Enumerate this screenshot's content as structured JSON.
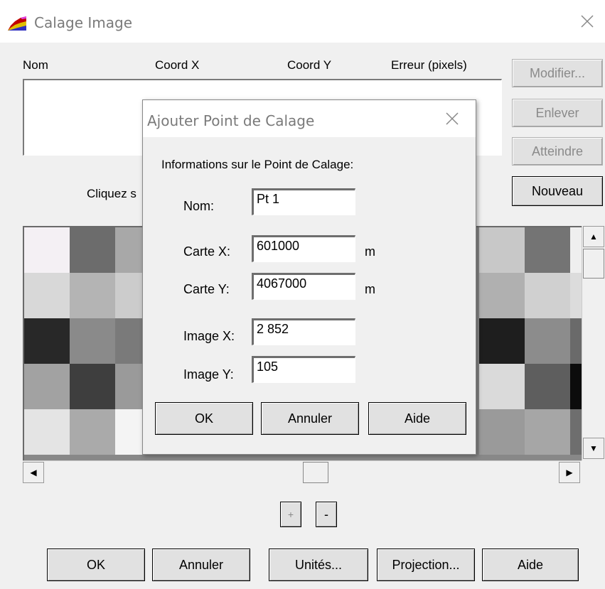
{
  "window": {
    "title": "Calage Image",
    "icon": "app-icon",
    "close_icon": "close-icon"
  },
  "list": {
    "columns": [
      "Nom",
      "Coord X",
      "Coord Y",
      "Erreur (pixels)"
    ],
    "rows": []
  },
  "side_buttons": {
    "modifier": "Modifier...",
    "enlever": "Enlever",
    "atteindre": "Atteindre",
    "nouveau": "Nouveau"
  },
  "instruction_text": "Cliquez s",
  "zoom": {
    "plus": "+",
    "minus": "-"
  },
  "footer_buttons": {
    "ok": "OK",
    "annuler": "Annuler",
    "unites": "Unités...",
    "projection": "Projection...",
    "aide": "Aide"
  },
  "dialog": {
    "title": "Ajouter Point de Calage",
    "section_label": "Informations sur le Point de Calage:",
    "fields": {
      "nom": {
        "label": "Nom:",
        "value": "Pt 1"
      },
      "carte_x": {
        "label": "Carte X:",
        "value": "601000",
        "unit": "m"
      },
      "carte_y": {
        "label": "Carte Y:",
        "value": "4067000",
        "unit": "m"
      },
      "image_x": {
        "label": "Image X:",
        "value": "2 852"
      },
      "image_y": {
        "label": "Image Y:",
        "value": "105"
      }
    },
    "buttons": {
      "ok": "OK",
      "annuler": "Annuler",
      "aide": "Aide"
    }
  }
}
